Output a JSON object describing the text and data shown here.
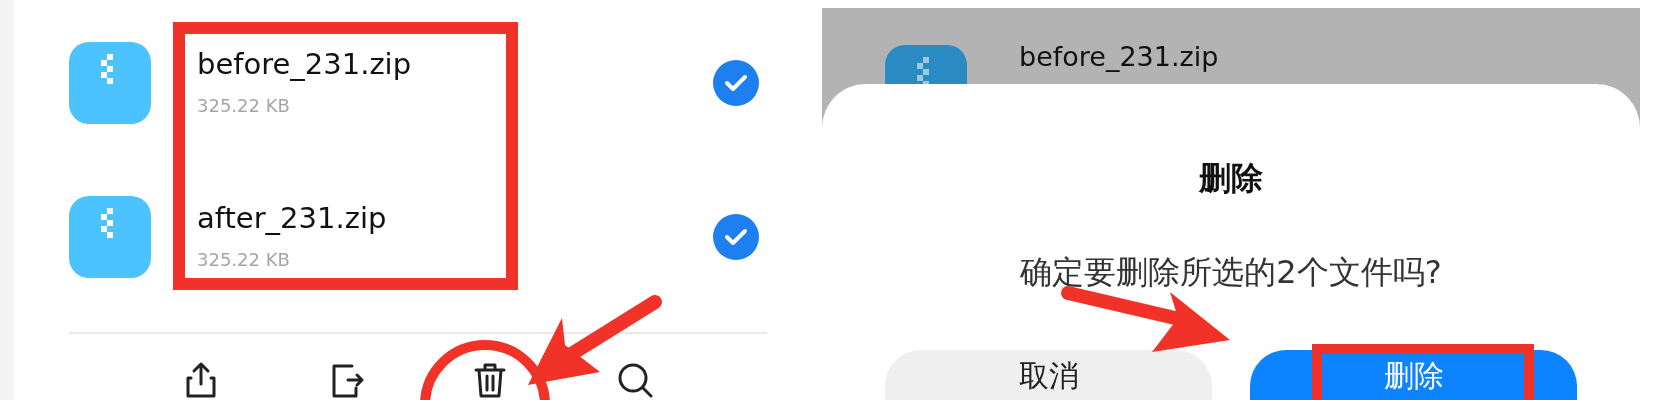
{
  "left_screen": {
    "files": [
      {
        "name": "before_231.zip",
        "size": "325.22 KB",
        "checked": true
      },
      {
        "name": "after_231.zip",
        "size": "325.22 KB",
        "checked": true
      }
    ],
    "toolbar": [
      {
        "kind": "share"
      },
      {
        "kind": "move"
      },
      {
        "kind": "delete"
      },
      {
        "kind": "search"
      }
    ]
  },
  "right_screen": {
    "background_file": {
      "name": "before_231.zip"
    },
    "dialog": {
      "title": "删除",
      "message": "确定要删除所选的2个文件吗?",
      "buttons": [
        {
          "label": "取消",
          "kind": "cancel"
        },
        {
          "label": "删除",
          "kind": "confirm"
        }
      ]
    }
  }
}
